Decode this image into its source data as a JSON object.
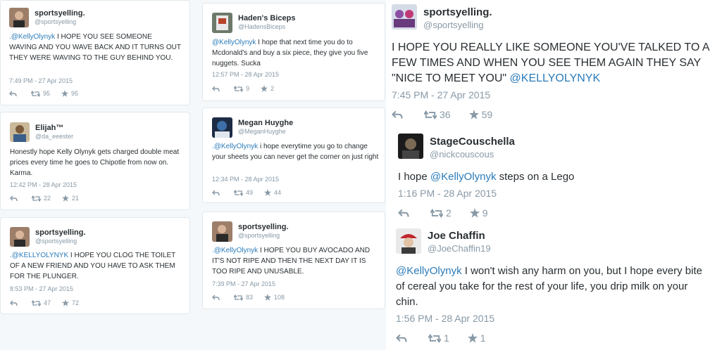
{
  "left": {
    "cards": [
      {
        "name": "sportsyelling.",
        "handle": "@sportsyelling",
        "mention": ".@KellyOlynyk",
        "text": " I HOPE YOU SEE SOMEONE WAVING AND YOU WAVE BACK AND IT TURNS OUT THEY WERE WAVING TO THE GUY BEHIND YOU.",
        "time": "7:49 PM - 27 Apr 2015",
        "retweets": "95",
        "favorites": "95"
      },
      {
        "name": "Haden's Biceps",
        "handle": "@HadensBiceps",
        "mention": "@KellyOlynyk",
        "text": " I hope that next time you do to Mcdonald's and buy a six piece, they give you five nuggets. Sucka",
        "time": "12:57 PM - 28 Apr 2015",
        "retweets": "9",
        "favorites": "2"
      },
      {
        "name": "Elijah™",
        "handle": "@da_eeester",
        "mention": "",
        "text": "Honestly hope Kelly Olynyk gets charged double meat prices every time he goes to Chipotle from now on. Karma.",
        "time": "12:42 PM - 28 Apr 2015",
        "retweets": "22",
        "favorites": "21"
      },
      {
        "name": "Megan Huyghe",
        "handle": "@MeganHuyghe",
        "mention": ".@KellyOlynyk",
        "text": " i hope everytime you go to change your sheets you can never get the corner on just right",
        "time": "12:34 PM - 28 Apr 2015",
        "retweets": "49",
        "favorites": "44"
      },
      {
        "name": "sportsyelling.",
        "handle": "@sportsyelling",
        "mention": ".@KELLYOLYNYK",
        "text": " I HOPE YOU CLOG THE TOILET OF A NEW FRIEND AND YOU HAVE TO ASK THEM FOR THE PLUNGER.",
        "time": "8:53 PM - 27 Apr 2015",
        "retweets": "47",
        "favorites": "72"
      },
      {
        "name": "sportsyelling.",
        "handle": "@sportsyelling",
        "mention": ".@KellyOlynyk",
        "text": " I HOPE YOU BUY AVOCADO AND IT'S NOT RIPE AND THEN THE NEXT DAY IT IS TOO RIPE AND UNUSABLE.",
        "time": "7:39 PM - 27 Apr 2015",
        "retweets": "83",
        "favorites": "108"
      }
    ]
  },
  "right": {
    "main": {
      "name": "sportsyelling.",
      "handle": "@sportsyelling",
      "text": "I HOPE YOU REALLY LIKE SOMEONE YOU'VE TALKED TO A FEW TIMES AND WHEN YOU SEE THEM AGAIN THEY SAY \"NICE TO MEET YOU\" ",
      "mention": "@KELLYOLYNYK",
      "time": "7:45 PM - 27 Apr 2015",
      "retweets": "36",
      "favorites": "59"
    },
    "second": {
      "name": "StageCouschella",
      "handle": "@nickcouscous",
      "text_before": "I hope ",
      "mention": "@KellyOlynyk",
      "text_after": " steps on a Lego",
      "time": "1:16 PM - 28 Apr 2015",
      "retweets": "2",
      "favorites": "9"
    },
    "third": {
      "name": "Joe Chaffin",
      "handle": "@JoeChaffin19",
      "mention": "@KellyOlynyk",
      "text": " I won't wish any harm on you, but I hope every bite of cereal you take for the rest of your life, you drip milk on your chin.",
      "time": "1:56 PM - 28 Apr 2015",
      "retweets": "1",
      "favorites": "1"
    }
  },
  "colors": {
    "link": "#2b7bb9",
    "meta": "#8899a6",
    "border": "#e1e8ed",
    "bg": "#f5f8fa"
  },
  "icons": [
    "reply-icon",
    "retweet-icon",
    "star-icon"
  ]
}
